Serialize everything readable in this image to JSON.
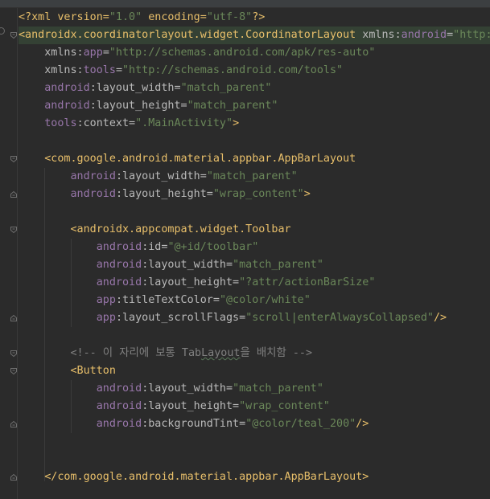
{
  "editor": {
    "lines": [
      [
        {
          "t": "<?xml version=",
          "c": "pi"
        },
        {
          "t": "\"1.0\"",
          "c": "val"
        },
        {
          "t": " encoding=",
          "c": "pi"
        },
        {
          "t": "\"utf-8\"",
          "c": "val"
        },
        {
          "t": "?>",
          "c": "pi"
        }
      ],
      [
        {
          "t": "<androidx.coordinatorlayout.widget.CoordinatorLayout",
          "c": "tag"
        },
        {
          "t": " xmlns:",
          "c": "attr"
        },
        {
          "t": "android",
          "c": "ns"
        },
        {
          "t": "=",
          "c": "attr"
        },
        {
          "t": "\"http:",
          "c": "val"
        }
      ],
      [
        {
          "t": "    xmlns:",
          "c": "attr"
        },
        {
          "t": "app",
          "c": "ns"
        },
        {
          "t": "=",
          "c": "attr"
        },
        {
          "t": "\"http://schemas.android.com/apk/res-auto\"",
          "c": "val"
        }
      ],
      [
        {
          "t": "    xmlns:",
          "c": "attr"
        },
        {
          "t": "tools",
          "c": "ns"
        },
        {
          "t": "=",
          "c": "attr"
        },
        {
          "t": "\"http://schemas.android.com/tools\"",
          "c": "val"
        }
      ],
      [
        {
          "t": "    ",
          "c": "attr"
        },
        {
          "t": "android",
          "c": "ns"
        },
        {
          "t": ":layout_width=",
          "c": "attr"
        },
        {
          "t": "\"match_parent\"",
          "c": "val"
        }
      ],
      [
        {
          "t": "    ",
          "c": "attr"
        },
        {
          "t": "android",
          "c": "ns"
        },
        {
          "t": ":layout_height=",
          "c": "attr"
        },
        {
          "t": "\"match_parent\"",
          "c": "val"
        }
      ],
      [
        {
          "t": "    ",
          "c": "attr"
        },
        {
          "t": "tools",
          "c": "ns"
        },
        {
          "t": ":context=",
          "c": "attr"
        },
        {
          "t": "\".MainActivity\"",
          "c": "val"
        },
        {
          "t": ">",
          "c": "tag"
        }
      ],
      [],
      [
        {
          "t": "    <com.google.android.material.appbar.AppBarLayout",
          "c": "tag"
        }
      ],
      [
        {
          "t": "        ",
          "c": "attr"
        },
        {
          "t": "android",
          "c": "ns"
        },
        {
          "t": ":layout_width=",
          "c": "attr"
        },
        {
          "t": "\"match_parent\"",
          "c": "val"
        }
      ],
      [
        {
          "t": "        ",
          "c": "attr"
        },
        {
          "t": "android",
          "c": "ns"
        },
        {
          "t": ":layout_height=",
          "c": "attr"
        },
        {
          "t": "\"wrap_content\"",
          "c": "val"
        },
        {
          "t": ">",
          "c": "tag"
        }
      ],
      [],
      [
        {
          "t": "        <androidx.appcompat.widget.Toolbar",
          "c": "tag"
        }
      ],
      [
        {
          "t": "            ",
          "c": "attr"
        },
        {
          "t": "android",
          "c": "ns"
        },
        {
          "t": ":id=",
          "c": "attr"
        },
        {
          "t": "\"@+id/toolbar\"",
          "c": "val"
        }
      ],
      [
        {
          "t": "            ",
          "c": "attr"
        },
        {
          "t": "android",
          "c": "ns"
        },
        {
          "t": ":layout_width=",
          "c": "attr"
        },
        {
          "t": "\"match_parent\"",
          "c": "val"
        }
      ],
      [
        {
          "t": "            ",
          "c": "attr"
        },
        {
          "t": "android",
          "c": "ns"
        },
        {
          "t": ":layout_height=",
          "c": "attr"
        },
        {
          "t": "\"?attr/actionBarSize\"",
          "c": "val"
        }
      ],
      [
        {
          "t": "            ",
          "c": "attr"
        },
        {
          "t": "app",
          "c": "ns"
        },
        {
          "t": ":titleTextColor=",
          "c": "attr"
        },
        {
          "t": "\"@color/white\"",
          "c": "val"
        }
      ],
      [
        {
          "t": "            ",
          "c": "attr"
        },
        {
          "t": "app",
          "c": "ns"
        },
        {
          "t": ":layout_scrollFlags=",
          "c": "attr"
        },
        {
          "t": "\"scroll|enterAlwaysCollapsed\"",
          "c": "val"
        },
        {
          "t": "/>",
          "c": "tag"
        }
      ],
      [],
      [
        {
          "t": "        <!-- 이 자리에 보통 Tab",
          "c": "cmt"
        },
        {
          "t": "Layout",
          "c": "cmt",
          "w": true
        },
        {
          "t": "을 배치함 -->",
          "c": "cmt"
        }
      ],
      [
        {
          "t": "        <Button",
          "c": "tag"
        }
      ],
      [
        {
          "t": "            ",
          "c": "attr"
        },
        {
          "t": "android",
          "c": "ns"
        },
        {
          "t": ":layout_width=",
          "c": "attr"
        },
        {
          "t": "\"match_parent\"",
          "c": "val"
        }
      ],
      [
        {
          "t": "            ",
          "c": "attr"
        },
        {
          "t": "android",
          "c": "ns"
        },
        {
          "t": ":layout_height=",
          "c": "attr"
        },
        {
          "t": "\"wrap_content\"",
          "c": "val"
        }
      ],
      [
        {
          "t": "            ",
          "c": "attr"
        },
        {
          "t": "android",
          "c": "ns"
        },
        {
          "t": ":backgroundTint=",
          "c": "attr"
        },
        {
          "t": "\"@color/teal_200\"",
          "c": "val"
        },
        {
          "t": "/>",
          "c": "tag"
        }
      ],
      [],
      [],
      [
        {
          "t": "    </com.google.android.material.appbar.AppBarLayout>",
          "c": "tag"
        }
      ]
    ],
    "highlighted_line": 2,
    "fold_markers": [
      {
        "line": 2,
        "kind": "open"
      },
      {
        "line": 9,
        "kind": "open"
      },
      {
        "line": 11,
        "kind": "close"
      },
      {
        "line": 13,
        "kind": "open"
      },
      {
        "line": 18,
        "kind": "close"
      },
      {
        "line": 20,
        "kind": "open"
      },
      {
        "line": 21,
        "kind": "open"
      },
      {
        "line": 24,
        "kind": "close"
      },
      {
        "line": 27,
        "kind": "close"
      }
    ]
  },
  "colors": {
    "background": "#2b2b2b",
    "tag": "#e8bf6a",
    "namespace": "#9876aa",
    "attribute": "#bababa",
    "value": "#6a8759",
    "comment": "#808080",
    "highlight_line": "#344134"
  }
}
